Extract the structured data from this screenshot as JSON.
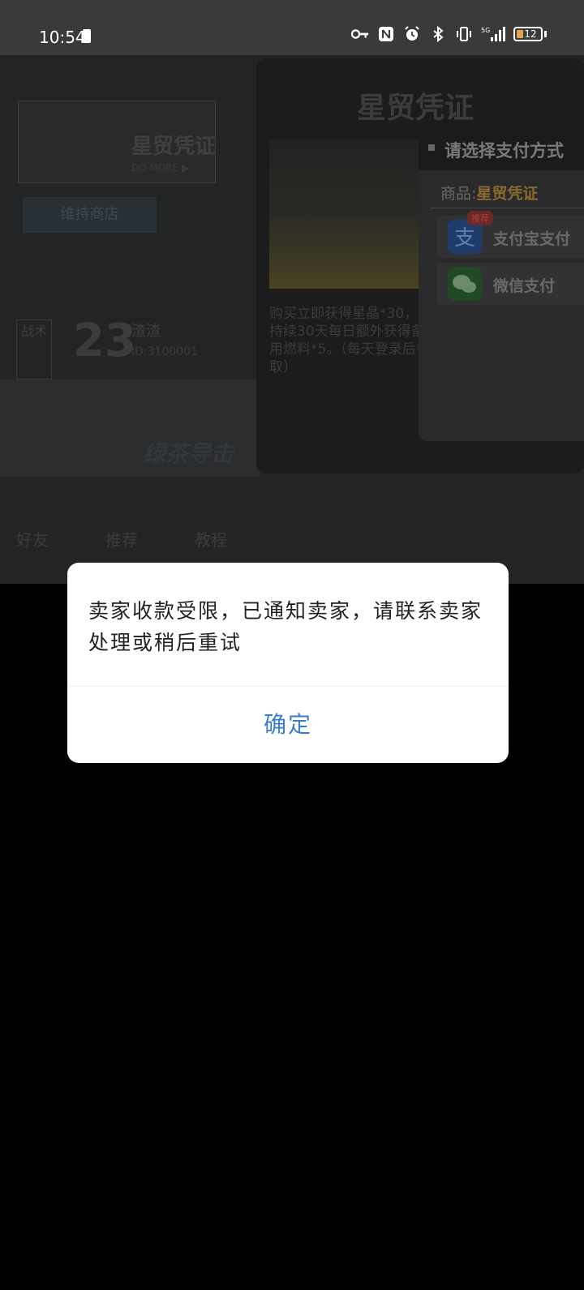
{
  "status_bar": {
    "time": "10:54",
    "battery_level": "12",
    "icons": [
      "key-icon",
      "nfc-icon",
      "alarm-icon",
      "bluetooth-icon",
      "vibrate-icon",
      "5g-signal-icon",
      "battery-icon"
    ]
  },
  "background_game": {
    "card_title": "星贸凭证",
    "card_sub": "DO MORE ▶",
    "left_button": "维持商店",
    "badge": "战术",
    "level_number": "23",
    "player_name": "渣渣",
    "player_id": "ID:3100001",
    "banner": "绿茶导击",
    "tabs": [
      "好友",
      "推荐",
      "教程"
    ],
    "panel_title": "星贸凭证",
    "panel_desc": "购买立即获得星晶*30，持续30天每日额外获得备用燃料*5。（每天登录后领取）"
  },
  "payment_sheet": {
    "header": "请选择支付方式",
    "product_label": "商品:",
    "product_name": "星贸凭证",
    "recommend_tag": "推荐",
    "options": [
      {
        "label": "支付宝支付",
        "icon": "alipay-icon",
        "color": "#1677ff"
      },
      {
        "label": "微信支付",
        "icon": "wechat-pay-icon",
        "color": "#09bb07"
      }
    ]
  },
  "dialog": {
    "message": "卖家收款受限，已通知卖家，请联系卖家处理或稍后重试",
    "confirm_label": "确定",
    "confirm_color": "#3b7bd0"
  }
}
